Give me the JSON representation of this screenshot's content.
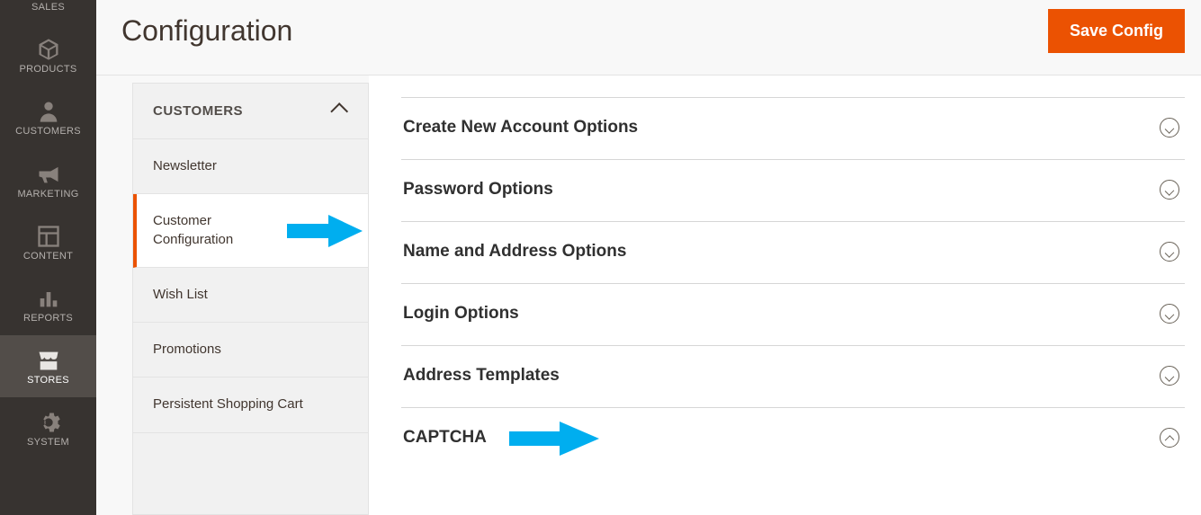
{
  "sidebar": {
    "items": [
      {
        "label": "SALES",
        "icon": "sales"
      },
      {
        "label": "PRODUCTS",
        "icon": "products"
      },
      {
        "label": "CUSTOMERS",
        "icon": "customers"
      },
      {
        "label": "MARKETING",
        "icon": "marketing"
      },
      {
        "label": "CONTENT",
        "icon": "content"
      },
      {
        "label": "REPORTS",
        "icon": "reports"
      },
      {
        "label": "STORES",
        "icon": "stores",
        "active": true
      },
      {
        "label": "SYSTEM",
        "icon": "system"
      }
    ]
  },
  "header": {
    "title": "Configuration",
    "save_label": "Save Config"
  },
  "config_tabs": {
    "section_title": "CUSTOMERS",
    "items": [
      {
        "label": "Newsletter"
      },
      {
        "label": "Customer Configuration",
        "active": true
      },
      {
        "label": "Wish List"
      },
      {
        "label": "Promotions"
      },
      {
        "label": "Persistent Shopping Cart"
      }
    ]
  },
  "config_sections": [
    {
      "title": "Create New Account Options",
      "expanded": false
    },
    {
      "title": "Password Options",
      "expanded": false
    },
    {
      "title": "Name and Address Options",
      "expanded": false
    },
    {
      "title": "Login Options",
      "expanded": false
    },
    {
      "title": "Address Templates",
      "expanded": false
    },
    {
      "title": "CAPTCHA",
      "expanded": true
    }
  ],
  "colors": {
    "accent": "#eb5202",
    "annotation": "#00aeef"
  }
}
